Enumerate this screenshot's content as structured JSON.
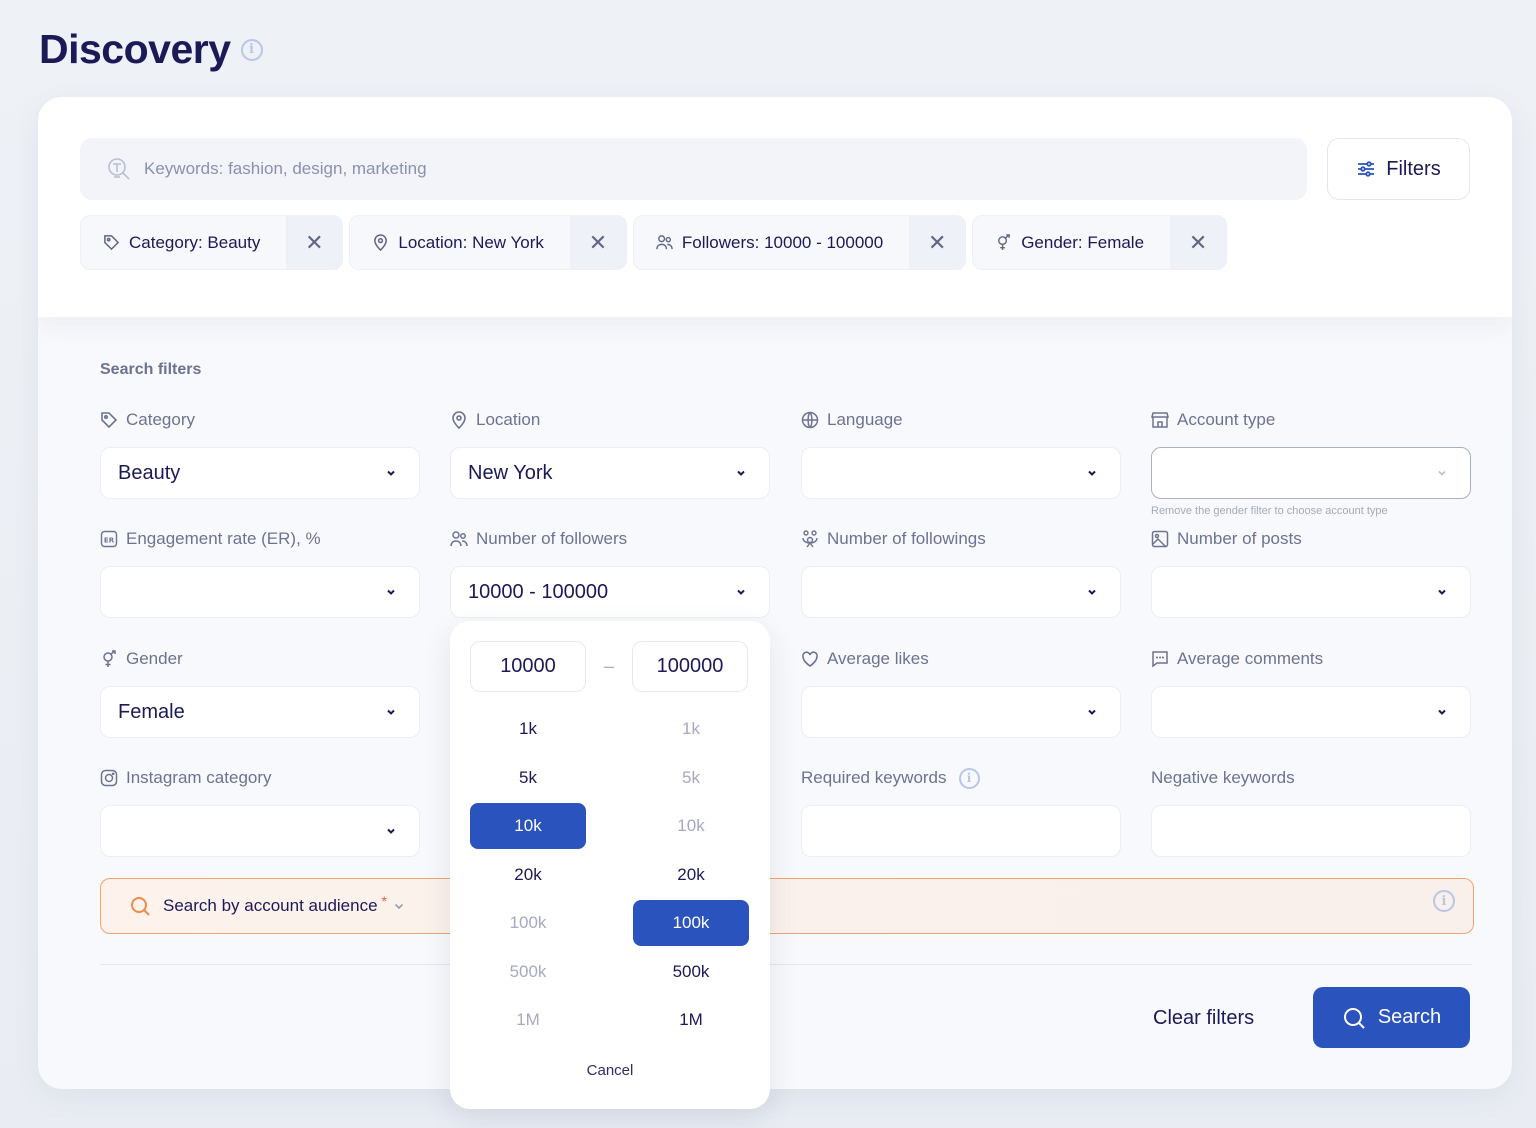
{
  "page": {
    "title": "Discovery"
  },
  "search": {
    "placeholder": "Keywords: fashion, design, marketing",
    "value": "",
    "filters_button": "Filters"
  },
  "active_filters": [
    {
      "icon": "tag-icon",
      "label": "Category: Beauty"
    },
    {
      "icon": "location-pin-icon",
      "label": "Location: New York"
    },
    {
      "icon": "users-icon",
      "label": "Followers: 10000 - 100000"
    },
    {
      "icon": "gender-icon",
      "label": "Gender: Female"
    }
  ],
  "filters_panel": {
    "title": "Search filters",
    "fields": {
      "category": {
        "label": "Category",
        "value": "Beauty"
      },
      "location": {
        "label": "Location",
        "value": "New York"
      },
      "language": {
        "label": "Language",
        "value": ""
      },
      "account_type": {
        "label": "Account type",
        "value": "",
        "hint": "Remove the gender filter to choose account type",
        "disabled": true
      },
      "engagement_rate": {
        "label": "Engagement rate (ER), %",
        "value": ""
      },
      "followers": {
        "label": "Number of followers",
        "value": "10000 - 100000"
      },
      "followings": {
        "label": "Number of followings",
        "value": ""
      },
      "posts": {
        "label": "Number of posts",
        "value": ""
      },
      "gender": {
        "label": "Gender",
        "value": "Female"
      },
      "avg_likes": {
        "label": "Average likes",
        "value": ""
      },
      "avg_comments": {
        "label": "Average comments",
        "value": ""
      },
      "instagram_category": {
        "label": "Instagram category",
        "value": ""
      },
      "required_keywords": {
        "label": "Required keywords",
        "value": ""
      },
      "negative_keywords": {
        "label": "Negative keywords",
        "value": ""
      }
    },
    "audience": {
      "label": "Search by account audience",
      "required_mark": "*"
    },
    "clear_button": "Clear filters",
    "search_button": "Search"
  },
  "followers_range_popover": {
    "min": "10000",
    "max": "100000",
    "separator": "–",
    "min_options": [
      {
        "label": "1k",
        "state": "enabled"
      },
      {
        "label": "5k",
        "state": "enabled"
      },
      {
        "label": "10k",
        "state": "selected"
      },
      {
        "label": "20k",
        "state": "enabled"
      },
      {
        "label": "100k",
        "state": "disabled"
      },
      {
        "label": "500k",
        "state": "disabled"
      },
      {
        "label": "1M",
        "state": "disabled"
      }
    ],
    "max_options": [
      {
        "label": "1k",
        "state": "disabled"
      },
      {
        "label": "5k",
        "state": "disabled"
      },
      {
        "label": "10k",
        "state": "disabled"
      },
      {
        "label": "20k",
        "state": "enabled"
      },
      {
        "label": "100k",
        "state": "selected"
      },
      {
        "label": "500k",
        "state": "enabled"
      },
      {
        "label": "1M",
        "state": "enabled"
      }
    ],
    "cancel": "Cancel"
  },
  "colors": {
    "primary": "#2b53bd",
    "title": "#1b1a57",
    "muted_text": "#6c7390",
    "audience_border": "#f3a46c",
    "audience_icon": "#f08a45"
  }
}
